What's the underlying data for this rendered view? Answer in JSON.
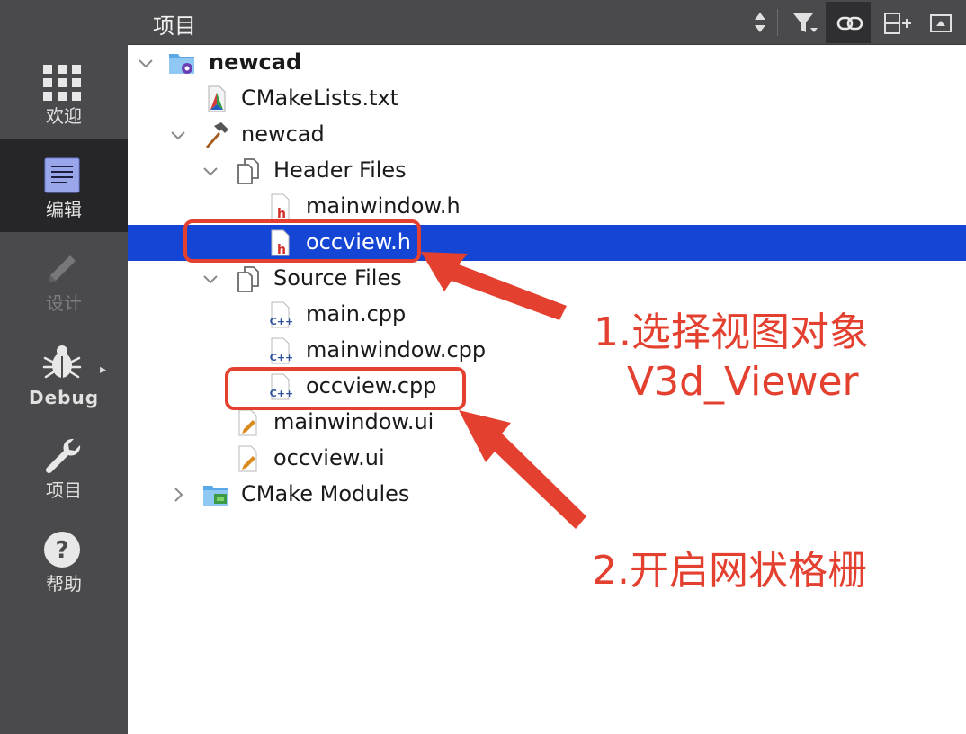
{
  "header": {
    "title": "项目",
    "buttons": [
      "sort-updown-icon",
      "filter-icon",
      "link-icon",
      "split-add-icon",
      "collapse-icon"
    ]
  },
  "modebar": {
    "items": [
      {
        "label": "欢迎",
        "icon": "grid-icon",
        "state": "normal"
      },
      {
        "label": "编辑",
        "icon": "document-icon",
        "state": "active"
      },
      {
        "label": "设计",
        "icon": "pencil-icon",
        "state": "disabled"
      },
      {
        "label": "Debug",
        "icon": "bug-icon",
        "state": "normal"
      },
      {
        "label": "项目",
        "icon": "wrench-icon",
        "state": "normal"
      },
      {
        "label": "帮助",
        "icon": "help-icon",
        "state": "normal"
      }
    ]
  },
  "tree": {
    "rows": [
      {
        "label": "newcad",
        "icon": "cmake-project-icon",
        "expanded": true,
        "bold": true
      },
      {
        "label": "CMakeLists.txt",
        "icon": "cmake-file-icon"
      },
      {
        "label": "newcad",
        "icon": "hammer-icon",
        "expanded": true
      },
      {
        "label": "Header Files",
        "icon": "folder-files-icon",
        "expanded": true
      },
      {
        "label": "mainwindow.h",
        "icon": "header-file-icon"
      },
      {
        "label": "occview.h",
        "icon": "header-file-icon",
        "selected": true
      },
      {
        "label": "Source Files",
        "icon": "folder-files-icon",
        "expanded": true
      },
      {
        "label": "main.cpp",
        "icon": "cpp-file-icon"
      },
      {
        "label": "mainwindow.cpp",
        "icon": "cpp-file-icon"
      },
      {
        "label": "occview.cpp",
        "icon": "cpp-file-icon"
      },
      {
        "label": "mainwindow.ui",
        "icon": "ui-file-icon"
      },
      {
        "label": "occview.ui",
        "icon": "ui-file-icon"
      },
      {
        "label": "CMake Modules",
        "icon": "cmake-modules-icon",
        "expanded": false
      }
    ]
  },
  "annotations": {
    "step1_line1": "1.选择视图对象",
    "step1_line2": "V3d_Viewer",
    "step2": "2.开启网状格栅",
    "color": "#e44030"
  },
  "colors": {
    "selection": "#1445d4",
    "sidebar": "#4a4a4c",
    "sidebar_active": "#262628"
  }
}
